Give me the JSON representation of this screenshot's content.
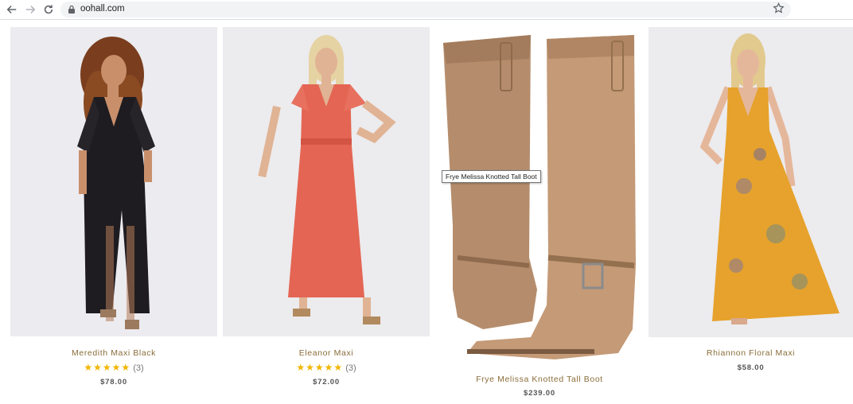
{
  "browser": {
    "url": "oohall.com",
    "icons": [
      "back-arrow-icon",
      "forward-arrow-icon",
      "reload-icon",
      "lock-icon",
      "bookmark-star-icon"
    ]
  },
  "products": [
    {
      "name": "Meredith Maxi Black",
      "stars": "★★★★★",
      "reviews": "(3)",
      "price": "$78.00"
    },
    {
      "name": "Eleanor Maxi",
      "stars": "★★★★★",
      "reviews": "(3)",
      "price": "$72.00"
    },
    {
      "name": "Frye Melissa Knotted Tall Boot",
      "price": "$239.00"
    },
    {
      "name": "Rhiannon Floral Maxi",
      "price": "$58.00"
    }
  ],
  "tooltip": {
    "text": "Frye Melissa Knotted Tall Boot"
  },
  "colors": {
    "accent_name": "#8a6d3b",
    "star": "#f2b600",
    "price": "#555555"
  }
}
